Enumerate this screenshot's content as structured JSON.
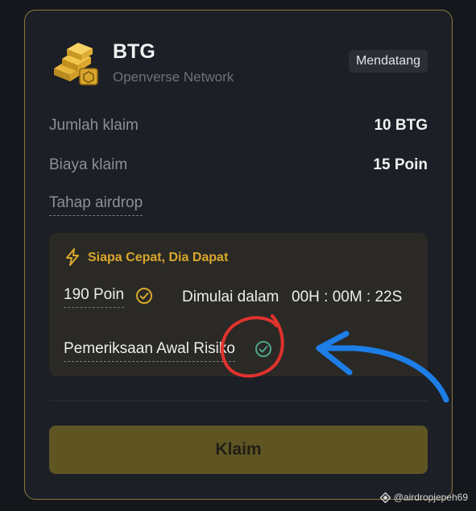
{
  "token": {
    "symbol": "BTG",
    "network": "Openverse Network",
    "status_badge": "Mendatang",
    "logo_icon": "gold-bars-icon"
  },
  "rows": {
    "claim_amount_label": "Jumlah klaim",
    "claim_amount_value": "10 BTG",
    "claim_fee_label": "Biaya klaim",
    "claim_fee_value": "15 Poin",
    "airdrop_stage_label": "Tahap airdrop"
  },
  "panel": {
    "title": "Siapa Cepat, Dia Dapat",
    "points": "190 Poin",
    "start_label": "Dimulai dalam",
    "countdown": "00H : 00M : 22S",
    "risk_check": "Pemeriksaan Awal Risiko"
  },
  "button": {
    "claim_label": "Klaim"
  },
  "watermark": {
    "text": "@airdropjepeh69"
  },
  "colors": {
    "accent_gold": "#d9a82c",
    "card_border": "#8a7a3c",
    "check_green": "#4ea58b",
    "annotation_red": "#e0322d",
    "annotation_blue": "#1d7ee8"
  }
}
